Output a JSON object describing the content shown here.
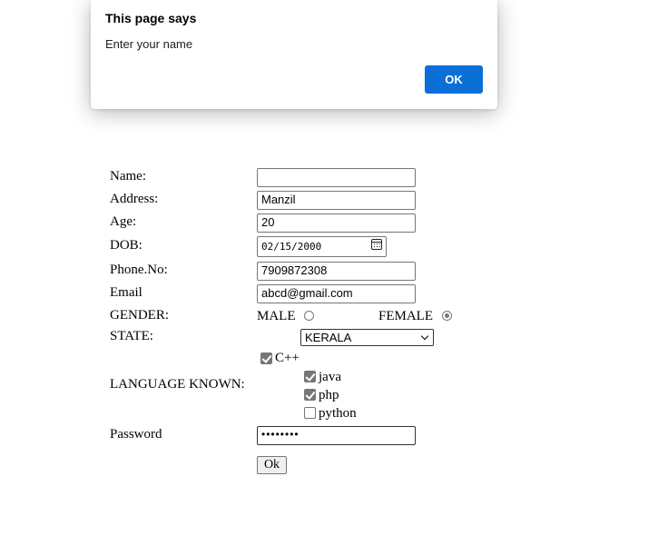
{
  "dialog": {
    "title": "This page says",
    "message": "Enter your name",
    "ok_label": "OK"
  },
  "form": {
    "name": {
      "label": "Name:",
      "value": ""
    },
    "address": {
      "label": "Address:",
      "value": "Manzil"
    },
    "age": {
      "label": "Age:",
      "value": "20"
    },
    "dob": {
      "label": "DOB:",
      "value": "02/15/2000"
    },
    "phone": {
      "label": "Phone.No:",
      "value": "7909872308"
    },
    "email": {
      "label": "Email",
      "value": "abcd@gmail.com"
    },
    "gender": {
      "label": "GENDER:",
      "male": "MALE",
      "female": "FEMALE",
      "selected": "FEMALE"
    },
    "state": {
      "label": "STATE:",
      "selected": "KERALA"
    },
    "languages": {
      "label": "LANGUAGE KNOWN:",
      "items": [
        {
          "label": "C++",
          "checked": true
        },
        {
          "label": "java",
          "checked": true
        },
        {
          "label": "php",
          "checked": true
        },
        {
          "label": "python",
          "checked": false
        }
      ]
    },
    "password": {
      "label": "Password",
      "value": "••••••••"
    },
    "submit_label": "Ok"
  },
  "icons": {
    "dob_picker": "calendar-icon",
    "state_dropdown": "chevron-down-icon"
  }
}
